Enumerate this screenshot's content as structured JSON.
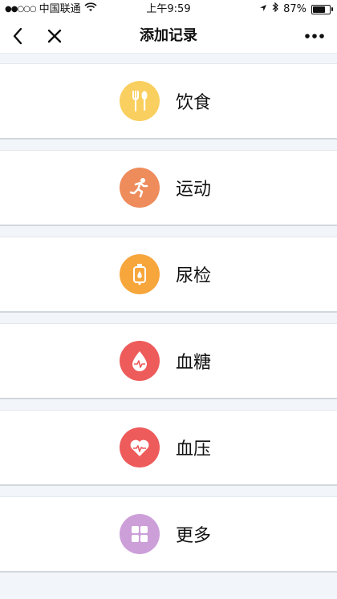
{
  "status": {
    "carrier": "中国联通",
    "time": "上午9:59",
    "battery": "87%",
    "battery_level": 0.87
  },
  "header": {
    "title": "添加记录",
    "back_icon": "chevron-left-icon",
    "close_icon": "close-icon",
    "more_icon": "more-dots-icon"
  },
  "records": [
    {
      "label": "饮食",
      "icon": "fork-knife-icon",
      "color": "#f9cf5f"
    },
    {
      "label": "运动",
      "icon": "running-icon",
      "color": "#ee8c5c"
    },
    {
      "label": "尿检",
      "icon": "urine-bag-icon",
      "color": "#f7a63c"
    },
    {
      "label": "血糖",
      "icon": "blood-drop-icon",
      "color": "#ee5b5b"
    },
    {
      "label": "血压",
      "icon": "heart-pulse-icon",
      "color": "#ee5b5b"
    },
    {
      "label": "更多",
      "icon": "grid-icon",
      "color": "#cc9fd9"
    }
  ]
}
